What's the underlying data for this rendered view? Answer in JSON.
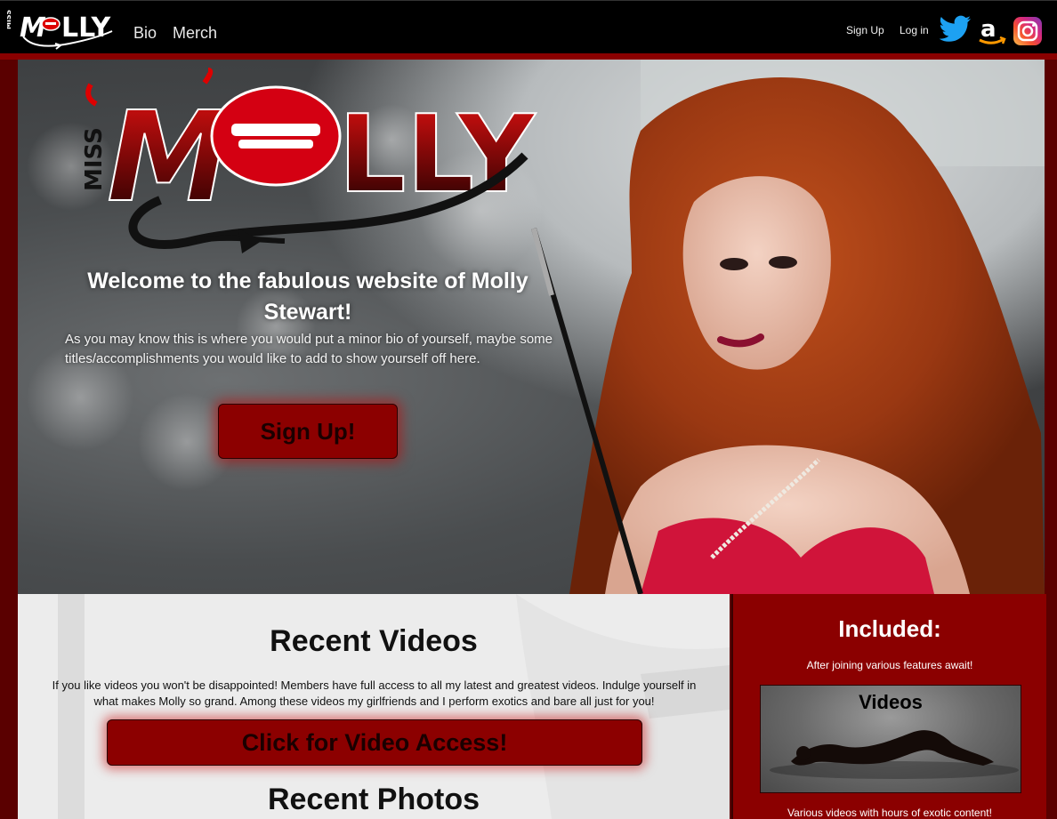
{
  "nav": {
    "links": [
      "Bio",
      "Merch"
    ],
    "signup": "Sign Up",
    "login": "Log in",
    "social": [
      "twitter-icon",
      "amazon-icon",
      "instagram-icon"
    ]
  },
  "hero": {
    "title": "Welcome to the fabulous website of Molly Stewart!",
    "bio": "As you may know this is where you would put a minor bio of yourself, maybe some titles/accomplishments you would like to add to show yourself off here.",
    "button": "Sign Up!"
  },
  "videos": {
    "title": "Recent Videos",
    "text": "If you like videos you won't be disappointed! Members have full access to all my latest and greatest videos. Indulge yourself in what makes Molly so grand. Among these videos my girlfriends and I perform exotics and bare all just for you!",
    "button": "Click for Video Access!"
  },
  "photos": {
    "title": "Recent Photos"
  },
  "included": {
    "title": "Included:",
    "subtitle": "After joining various features await!",
    "card_title": "Videos",
    "caption": "Various videos with hours of exotic content!"
  },
  "colors": {
    "accent": "#8b0000",
    "nav_bg": "#000000",
    "border": "#5a0000"
  }
}
